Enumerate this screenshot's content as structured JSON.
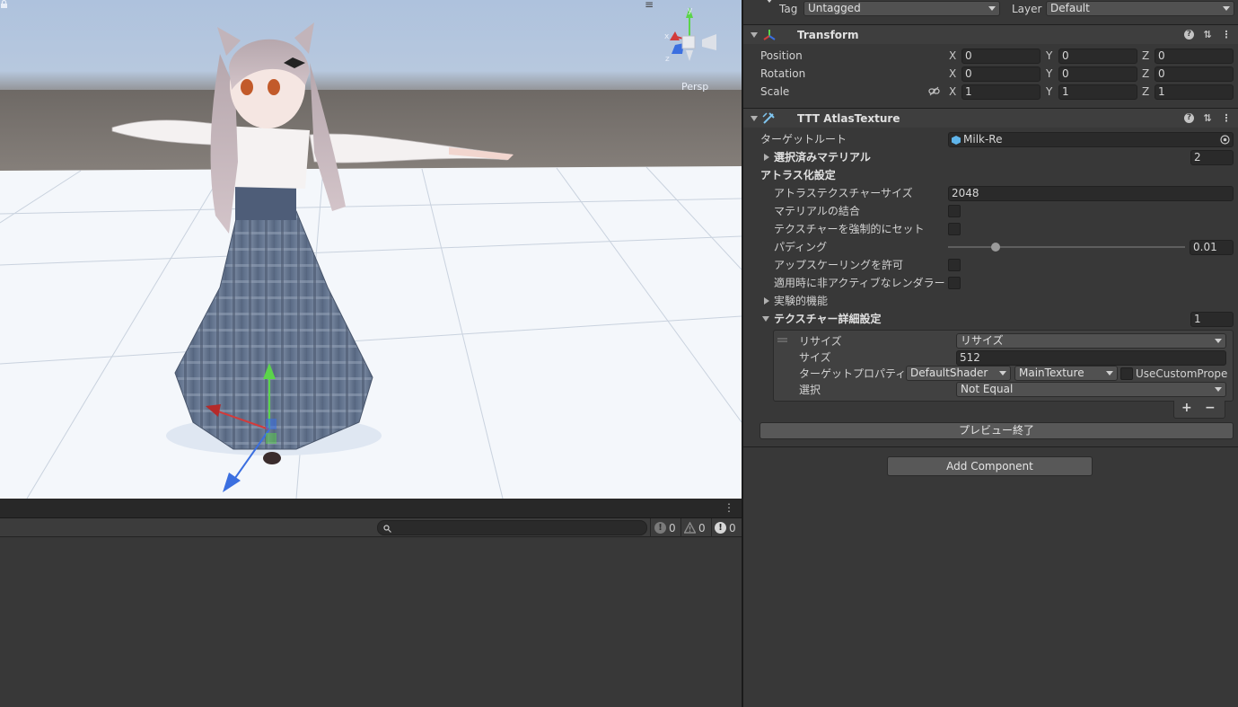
{
  "scene": {
    "persp_label": "Persp",
    "menu_glyph": "≡",
    "colors": {
      "sky_top": "#aec2dd",
      "horizon": "#6f6a66",
      "ground_far": "#75706b",
      "floor": "#f4f7fb",
      "grid": "#c9d2de"
    }
  },
  "console": {
    "kebab": "⋮",
    "search_placeholder": "",
    "counts": {
      "info": "0",
      "warning": "0",
      "error": "0"
    },
    "icons": {
      "search": "search-icon",
      "info": "info-icon",
      "warning": "warning-icon",
      "error": "error-icon"
    }
  },
  "inspector": {
    "tag_label": "Tag",
    "tag_value": "Untagged",
    "layer_label": "Layer",
    "layer_value": "Default",
    "transform": {
      "title": "Transform",
      "position": {
        "label": "Position",
        "x": "0",
        "y": "0",
        "z": "0"
      },
      "rotation": {
        "label": "Rotation",
        "x": "0",
        "y": "0",
        "z": "0"
      },
      "scale": {
        "label": "Scale",
        "x": "1",
        "y": "1",
        "z": "1"
      },
      "axes": {
        "x": "X",
        "y": "Y",
        "z": "Z"
      }
    },
    "atlas": {
      "title": "TTT AtlasTexture",
      "target_root_label": "ターゲットルート",
      "target_root_value": "Milk-Re",
      "selected_materials_label": "選択済みマテリアル",
      "selected_materials_count": "2",
      "atlas_settings_label": "アトラス化設定",
      "atlas_size_label": "アトラステクスチャーサイズ",
      "atlas_size_value": "2048",
      "merge_materials_label": "マテリアルの結合",
      "force_set_texture_label": "テクスチャーを強制的にセット",
      "padding_label": "パディング",
      "padding_value": "0.01",
      "padding_fraction": 0.01,
      "allow_upscaling_label": "アップスケーリングを許可",
      "include_inactive_label": "適用時に非アクティブなレンダラーを含める",
      "experimental_label": "実験的機能",
      "texture_detail_label": "テクスチャー詳細設定",
      "texture_detail_count": "1",
      "entry": {
        "resize_label": "リサイズ",
        "resize_value": "リサイズ",
        "size_label": "サイズ",
        "size_value": "512",
        "target_prop_label": "ターゲットプロパティネーム",
        "shader_value": "DefaultShader",
        "texture_value": "MainTexture",
        "use_custom_label": "UseCustomProper",
        "select_label": "選択",
        "select_value": "Not Equal"
      },
      "add_glyph": "+",
      "remove_glyph": "−",
      "preview_end_label": "プレビュー終了"
    },
    "add_component_label": "Add Component"
  }
}
